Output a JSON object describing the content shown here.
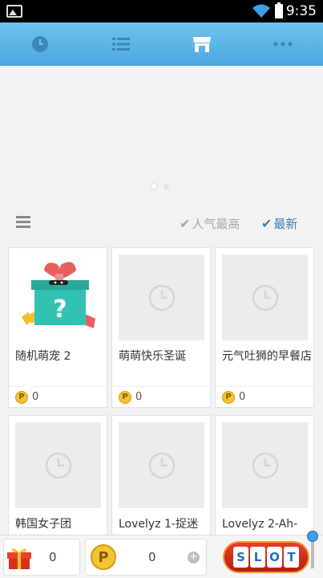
{
  "status_bar": {
    "time": "9:35"
  },
  "nav": {
    "tabs": [
      {
        "icon": "clock-icon",
        "active": false
      },
      {
        "icon": "list-icon",
        "active": false
      },
      {
        "icon": "store-icon",
        "active": true
      },
      {
        "icon": "more-icon",
        "active": false
      }
    ]
  },
  "filter": {
    "popular_label": "人气最高",
    "latest_label": "最新"
  },
  "items": [
    {
      "name": "随机萌宠 2",
      "price": "0"
    },
    {
      "name": "萌萌快乐圣诞",
      "price": "0"
    },
    {
      "name": "元气吐狮的早餐店",
      "price": "0"
    },
    {
      "name": "韩国女子团",
      "price": ""
    },
    {
      "name": "Lovelyz 1-捉迷",
      "price": ""
    },
    {
      "name": "Lovelyz 2-Ah-",
      "price": ""
    }
  ],
  "coin_symbol": "P",
  "bottom": {
    "gift_count": "0",
    "coin_count": "0",
    "slot_letters": [
      "S",
      "L",
      "O",
      "T"
    ]
  },
  "colors": {
    "nav_top": "#6fc3ee",
    "nav_bottom": "#4aa8df",
    "latest": "#3a7fb6",
    "slot": "#d8321f"
  }
}
